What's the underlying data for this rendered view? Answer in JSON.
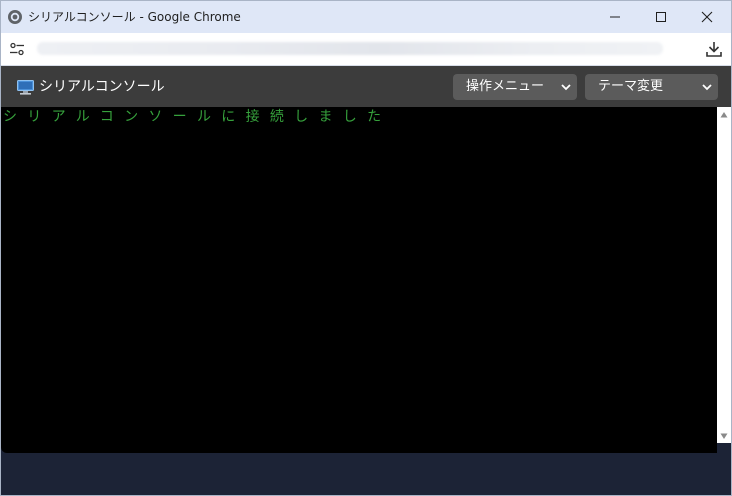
{
  "window": {
    "title": "シリアルコンソール - Google Chrome",
    "controls": [
      "minimize-icon",
      "maximize-icon",
      "close-icon"
    ]
  },
  "browser": {
    "site_info_icon": "tune-icon",
    "download_icon": "download-icon"
  },
  "app": {
    "icon": "computer-icon",
    "title": "シリアルコンソール",
    "operation_menu": {
      "selected": "操作メニュー"
    },
    "theme_menu": {
      "selected": "テーマ変更"
    }
  },
  "terminal": {
    "lines": [
      "シリアルコンソールに接続しました"
    ],
    "text_color": "#36a13c",
    "background": "#000000"
  },
  "colors": {
    "titlebar": "#dfe7f7",
    "header": "#3c3c3c",
    "select": "#5b5b5b",
    "footer": "#1c2336"
  }
}
